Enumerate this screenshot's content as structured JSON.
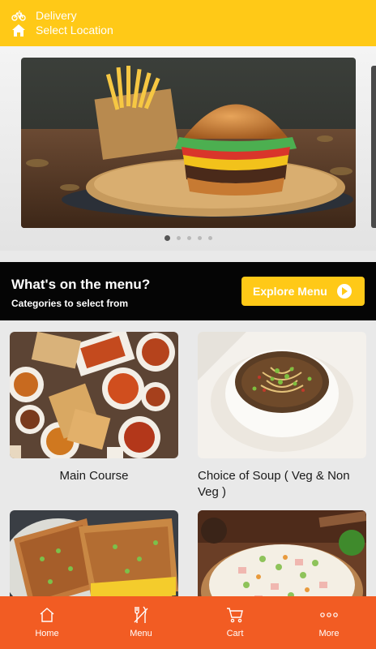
{
  "header": {
    "delivery_label": "Delivery",
    "location_label": "Select Location"
  },
  "banner": {
    "slide_count": 5,
    "active_index": 0
  },
  "menu_section": {
    "title": "What's on the menu?",
    "subtitle": "Categories to select from",
    "explore_label": "Explore Menu"
  },
  "categories": [
    {
      "label": "Main Course"
    },
    {
      "label": "Choice of Soup ( Veg & Non Veg )"
    },
    {
      "label": ""
    },
    {
      "label": ""
    }
  ],
  "bottom_nav": [
    {
      "label": "Home",
      "icon": "home-icon"
    },
    {
      "label": "Menu",
      "icon": "utensils-icon"
    },
    {
      "label": "Cart",
      "icon": "cart-icon"
    },
    {
      "label": "More",
      "icon": "more-icon"
    }
  ],
  "colors": {
    "header_bg": "#ffc917",
    "accent": "#ffc917",
    "nav_bg": "#f25c23",
    "menu_band_bg": "#050505"
  }
}
